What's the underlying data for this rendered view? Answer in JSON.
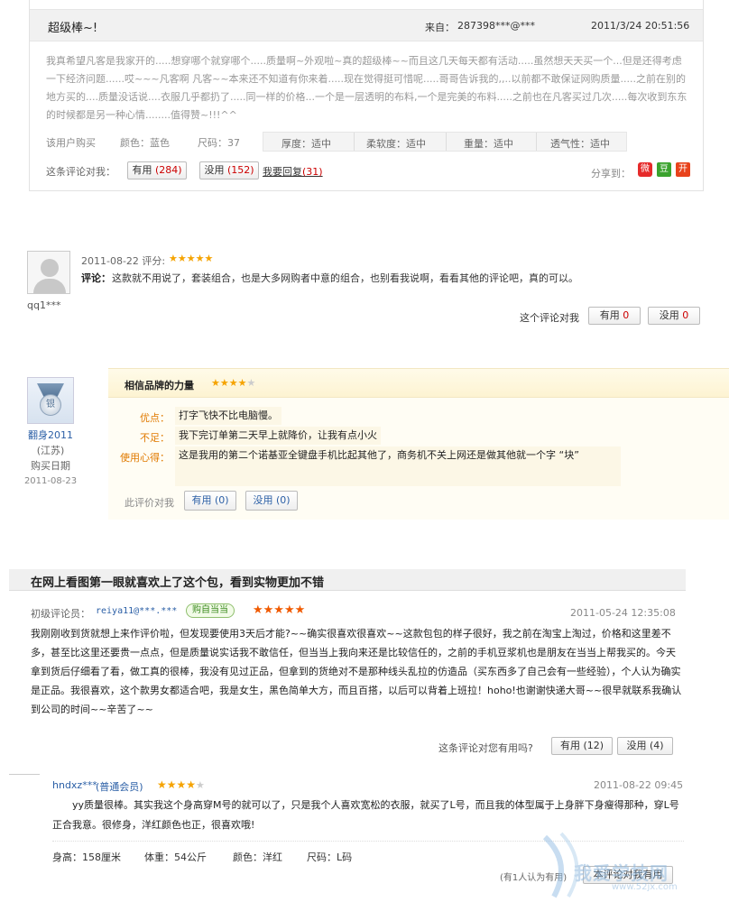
{
  "review1": {
    "title": "超级棒~!",
    "from_label": "来自：",
    "user": "287398***@***",
    "datetime": "2011/3/24 20:51:56",
    "body": "我真希望凡客是我家开的.....想穿哪个就穿哪个.....质量啊~外观啦~真的超级棒~~而且这几天每天都有活动.....虽然想天天买一个...但是还得考虑一下经济问题......哎~~~凡客啊 凡客~~本来还不知道有你来着.....现在觉得挺可惜呢.....哥哥告诉我的,,..以前都不敢保证网购质量.....之前在别的地方买的....质量没话说....衣服几乎都扔了.....同一样的价格...一个是一层透明的布料,一个是完美的布料.....之前也在凡客买过几次.....每次收到东东的时候都是另一种心情........值得赞~!!!^^",
    "buyer": "该用户购买",
    "color": "颜色：蓝色",
    "size": "尺码：37",
    "attrs": [
      "厚度：适中",
      "柔软度：适中",
      "重量：适中",
      "透气性：适中"
    ],
    "helpful_prompt": "这条评论对我：",
    "useful_label": "有用",
    "useful_count": "(284)",
    "useless_label": "没用",
    "useless_count": "(152)",
    "reply_label": "我要回复",
    "reply_count": "(31)",
    "share_label": "分享到："
  },
  "review2": {
    "date_line": "2011-08-22 评分:",
    "stars": 5,
    "comment_label": "评论：",
    "comment": "这款就不用说了，套装组合，也是大多网购者中意的组合，也别看我说啊，看看其他的评论吧，真的可以。",
    "username": "qq1***",
    "helpful_prompt": "这个评论对我",
    "useful": "有用",
    "useful_count": "0",
    "useless": "没用",
    "useless_count": "0"
  },
  "review3": {
    "badge_text": "银",
    "username": "翻身2011",
    "location": "(江苏)",
    "buy_date_label": "购买日期",
    "buy_date": "2011-08-23",
    "title": "相信品牌的力量",
    "stars": 4,
    "pros_label": "优点：",
    "pros": "打字飞快不比电脑慢。",
    "cons_label": "不足：",
    "cons": "我下完订单第二天早上就降价，让我有点小火",
    "exp_label": "使用心得：",
    "exp": "这是我用的第二个诺基亚全键盘手机比起其他了，商务机不关上网还是做其他就一个字 “块”",
    "helpful_prompt": "此评价对我",
    "useful": "有用 (0)",
    "useless": "没用 (0)"
  },
  "review4": {
    "title": "在网上看图第一眼就喜欢上了这个包，看到实物更加不错",
    "level": "初级评论员：",
    "user": "reiya11@***.***",
    "tag": "购自当当",
    "stars": 5,
    "datetime": "2011-05-24 12:35:08",
    "body": "我刚刚收到货就想上来作评价啦，但发现要使用3天后才能?~~确实很喜欢很喜欢~~这款包包的样子很好，我之前在淘宝上淘过，价格和这里差不多，甚至比这里还要贵一点点，但是质量说实话我不敢信任，但当当上我向来还是比较信任的，之前的手机豆浆机也是朋友在当当上帮我买的。今天拿到货后仔细看了看，做工真的很棒，我没有见过正品，但拿到的货绝对不是那种线头乱拉的仿造品（买东西多了自己会有一些经验），个人认为确实是正品。我很喜欢，这个款男女都适合吧，我是女生，黑色简单大方，而且百搭，以后可以背着上班拉！hoho!也谢谢快递大哥~~很早就联系我确认到公司的时间~~辛苦了~~",
    "helpful_prompt": "这条评论对您有用吗?",
    "useful": "有用 (12)",
    "useless": "没用 (4)"
  },
  "review5": {
    "user": "hndxz***",
    "member": "(普通会员)",
    "stars": 4,
    "datetime": "2011-08-22 09:45",
    "body": "yy质量很棒。其实我这个身高穿M号的就可以了，只是我个人喜欢宽松的衣服，就买了L号，而且我的体型属于上身胖下身瘦得那种，穿L号正合我意。很修身，洋红颜色也正，很喜欢哦!",
    "height": "身高：158厘米",
    "weight": "体重：54公斤",
    "color": "颜色：洋红",
    "size": "尺码：L码",
    "helpful_note": "(有1人认为有用)",
    "useful_button": "本评论对我有用"
  },
  "watermark": {
    "site": "我爱学技网",
    "url": "www.52jx.com"
  }
}
